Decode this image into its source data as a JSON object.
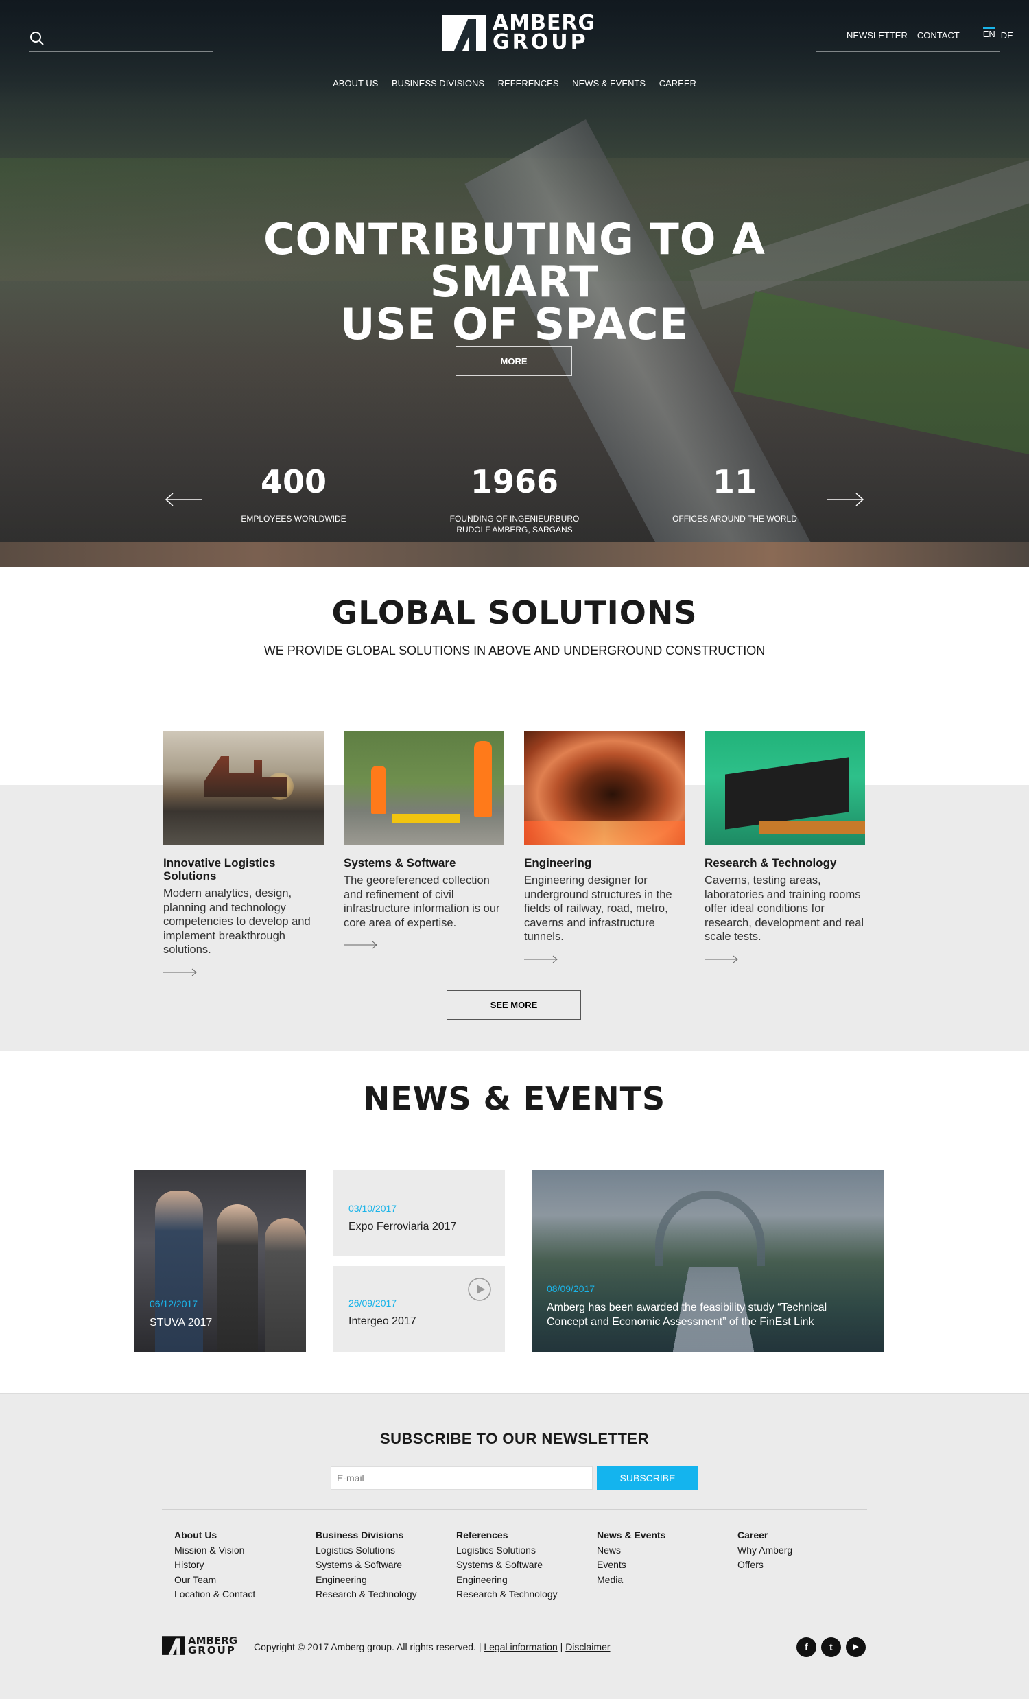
{
  "header": {
    "search_placeholder": "",
    "logo_word1": "AMBERG",
    "logo_word2": "GROUP",
    "newsletter": "NEWSLETTER",
    "contact": "CONTACT",
    "lang_en": "EN",
    "lang_de": "DE"
  },
  "nav": [
    "ABOUT US",
    "BUSINESS DIVISIONS",
    "REFERENCES",
    "NEWS & EVENTS",
    "CAREER"
  ],
  "hero": {
    "title_line1": "CONTRIBUTING TO A SMART",
    "title_line2": "USE OF SPACE",
    "more": "MORE",
    "stats": [
      {
        "num": "400",
        "label1": "EMPLOYEES WORLDWIDE",
        "label2": ""
      },
      {
        "num": "1966",
        "label1": "FOUNDING OF INGENIEURBÜRO",
        "label2": "RUDOLF AMBERG, SARGANS"
      },
      {
        "num": "11",
        "label1": "OFFICES AROUND THE WORLD",
        "label2": ""
      }
    ]
  },
  "global": {
    "title": "GLOBAL SOLUTIONS",
    "subtitle": "WE PROVIDE GLOBAL SOLUTIONS IN ABOVE AND UNDERGROUND CONSTRUCTION",
    "cards": [
      {
        "title": "Innovative Logistics Solutions",
        "desc": "Modern analytics, design, planning and technology competencies to develop and implement breakthrough solutions."
      },
      {
        "title": "Systems & Software",
        "desc": "The georeferenced collection and refinement of civil infrastructure information is our core area of expertise."
      },
      {
        "title": "Engineering",
        "desc": "Engineering designer for underground structures in the fields of railway, road, metro, caverns and infrastructure tunnels."
      },
      {
        "title": "Research & Technology",
        "desc": "Caverns, testing areas, laboratories and training rooms offer ideal conditions for research, development and real scale tests."
      }
    ],
    "see_more": "SEE MORE"
  },
  "news": {
    "title": "NEWS & EVENTS",
    "items": [
      {
        "date": "06/12/2017",
        "title": "STUVA 2017"
      },
      {
        "date": "03/10/2017",
        "title": "Expo Ferroviaria 2017"
      },
      {
        "date": "26/09/2017",
        "title": "Intergeo 2017"
      },
      {
        "date": "08/09/2017",
        "title": "Amberg has been awarded the feasibility study “Technical Concept and Economic Assessment” of the FinEst Link"
      }
    ]
  },
  "newsletter": {
    "title": "SUBSCRIBE TO OUR NEWSLETTER",
    "placeholder": "E-mail",
    "button": "SUBSCRIBE"
  },
  "footer": {
    "columns": [
      {
        "heading": "About Us",
        "links": [
          "Mission & Vision",
          "History",
          "Our Team",
          "Location & Contact"
        ]
      },
      {
        "heading": "Business Divisions",
        "links": [
          "Logistics Solutions",
          "Systems & Software",
          "Engineering",
          "Research & Technology"
        ]
      },
      {
        "heading": "References",
        "links": [
          "Logistics Solutions",
          "Systems & Software",
          "Engineering",
          "Research & Technology"
        ]
      },
      {
        "heading": "News & Events",
        "links": [
          "News",
          "Events",
          "Media"
        ]
      },
      {
        "heading": "Career",
        "links": [
          "Why Amberg",
          "Offers"
        ]
      }
    ],
    "logo_word1": "AMBERG",
    "logo_word2": "GROUP",
    "copyright": "Copyright © 2017 Amberg group. All rights reserved.",
    "sep": "|",
    "legal": "Legal information",
    "disclaimer": "Disclaimer",
    "social": {
      "facebook": "f",
      "twitter": "t",
      "youtube": "▶"
    }
  },
  "colors": {
    "accent": "#14b4ee",
    "dark": "#1a1a1a",
    "light_gray": "#ebebeb"
  }
}
